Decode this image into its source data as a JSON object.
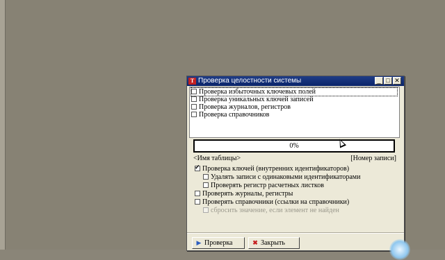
{
  "window": {
    "title": "Проверка целостности системы",
    "icon": "app-logo-icon",
    "controls": {
      "minimize": "_",
      "maximize": "□",
      "close": "✕"
    }
  },
  "check_list": [
    {
      "label": "Проверка избыточных ключевых полей",
      "checked": false
    },
    {
      "label": "Проверка уникальных ключей записей",
      "checked": false
    },
    {
      "label": "Проверка журналов, регистров",
      "checked": false
    },
    {
      "label": "Проверка справочников",
      "checked": false
    }
  ],
  "progress": {
    "text": "0%",
    "value": 0
  },
  "status": {
    "table_name": "<Имя таблицы>",
    "record_number": "[Номер записи]"
  },
  "options": [
    {
      "label": "Проверка ключей (внутренних идентификаторов)",
      "checked": true,
      "disabled": false
    },
    {
      "label": "Удалять записи с одинаковыми идентификаторами",
      "checked": false,
      "disabled": false
    },
    {
      "label": "Проверять регистр расчетных листков",
      "checked": false,
      "disabled": false
    },
    {
      "label": "Проверять журналы, регистры",
      "checked": false,
      "disabled": false
    },
    {
      "label": "Проверять справочники (ссылки на справочники)",
      "checked": false,
      "disabled": false
    },
    {
      "label": "сбросить значение, если элемент не найден",
      "checked": false,
      "disabled": true
    }
  ],
  "buttons": {
    "check": {
      "label": "Проверка",
      "icon": "play-icon"
    },
    "close": {
      "label": "Закрыть",
      "icon": "close-x-icon"
    }
  }
}
